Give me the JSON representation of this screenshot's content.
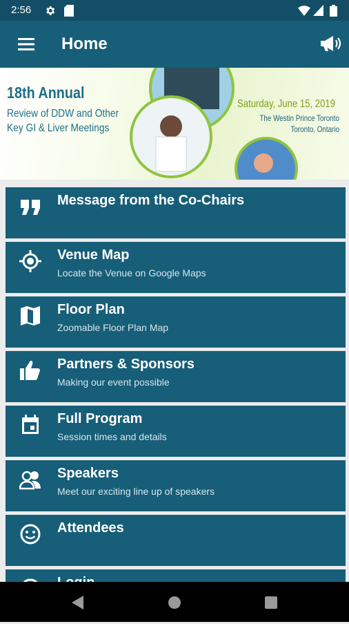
{
  "status_bar": {
    "time": "2:56"
  },
  "app_bar": {
    "title": "Home"
  },
  "banner": {
    "title": "18th Annual",
    "subtitle_line1": "Review of DDW and Other",
    "subtitle_line2": "Key GI & Liver Meetings",
    "date": "Saturday, June 15, 2019",
    "venue_line1": "The Westin Prince Toronto",
    "venue_line2": "Toronto, Ontario"
  },
  "menu_items": [
    {
      "title": "Message from the Co-Chairs",
      "subtitle": "",
      "icon": "quote-icon"
    },
    {
      "title": "Venue Map",
      "subtitle": "Locate the Venue on Google Maps",
      "icon": "location-target-icon"
    },
    {
      "title": "Floor Plan",
      "subtitle": "Zoomable Floor Plan Map",
      "icon": "map-icon"
    },
    {
      "title": "Partners & Sponsors",
      "subtitle": "Making our event possible",
      "icon": "thumbs-up-icon"
    },
    {
      "title": "Full Program",
      "subtitle": "Session times and details",
      "icon": "calendar-icon"
    },
    {
      "title": "Speakers",
      "subtitle": "Meet our exciting line up of speakers",
      "icon": "people-icon"
    },
    {
      "title": "Attendees",
      "subtitle": "",
      "icon": "smiley-face-icon"
    },
    {
      "title": "Login",
      "subtitle": "",
      "icon": "login-icon"
    }
  ],
  "colors": {
    "app_bar": "#175e78",
    "status_bar": "#134e66",
    "card": "#175e78",
    "background": "#ececec"
  }
}
